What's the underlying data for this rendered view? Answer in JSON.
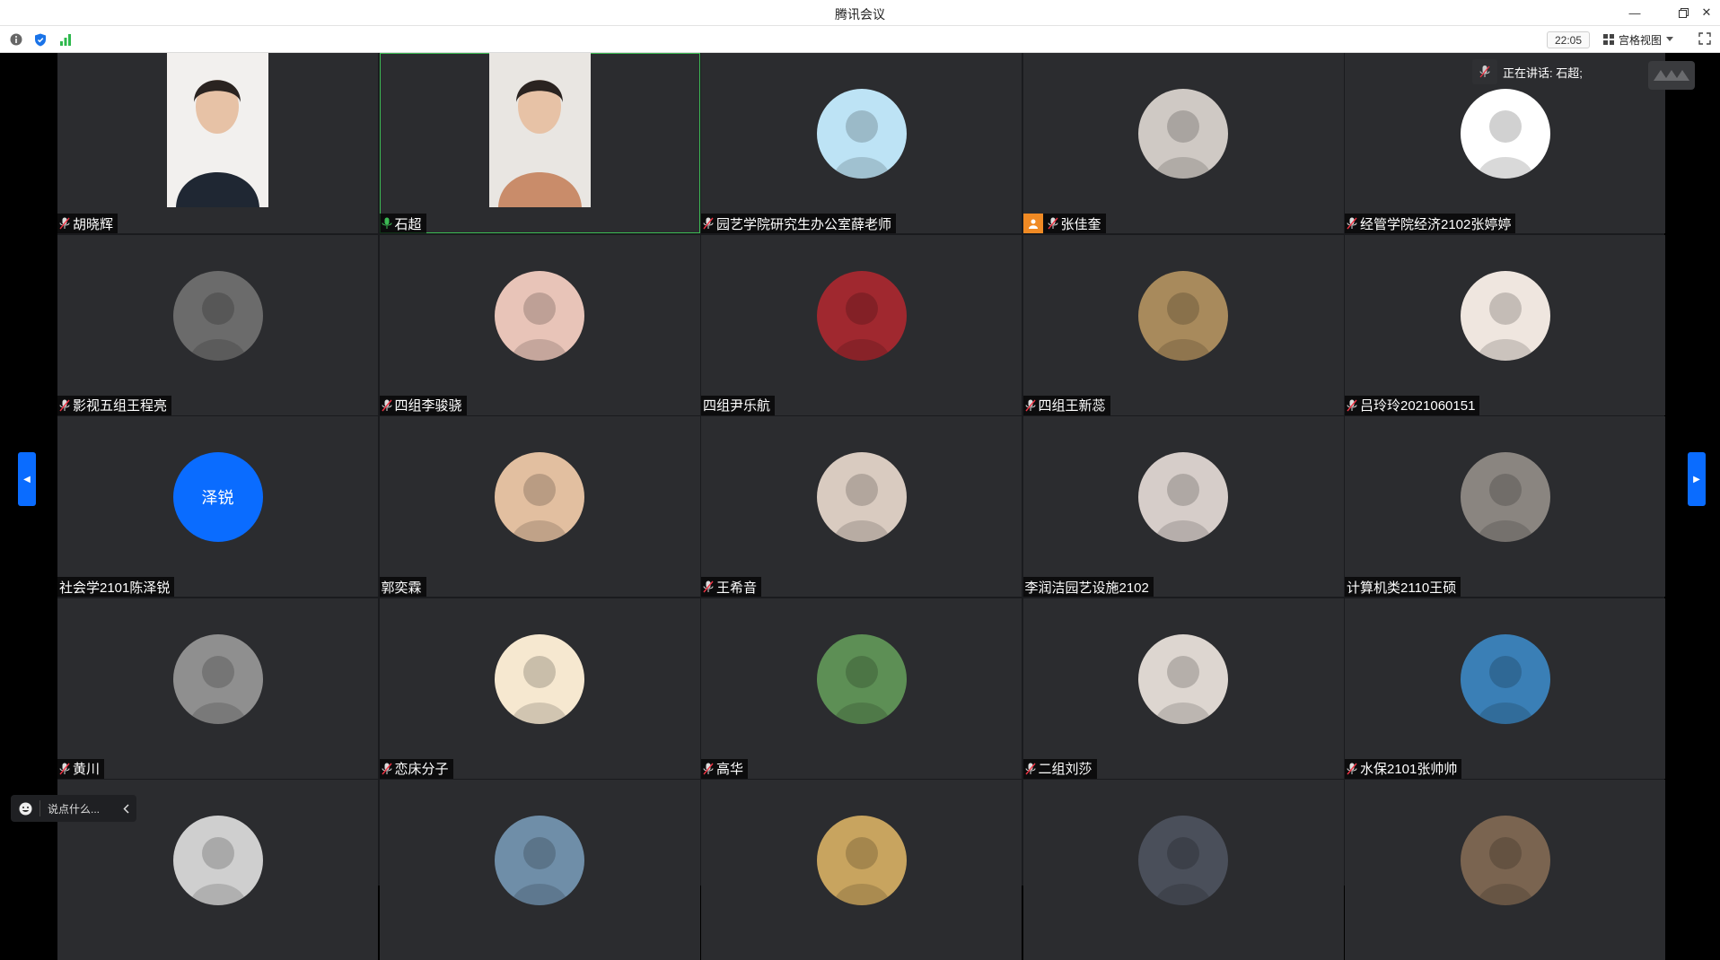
{
  "window": {
    "title": "腾讯会议"
  },
  "toolbar": {
    "time": "22:05",
    "view_label": "宫格视图"
  },
  "speaker": {
    "label": "正在讲话: 石超;"
  },
  "chat": {
    "placeholder": "说点什么..."
  },
  "participants": [
    {
      "name": "胡晓辉",
      "mic": "muted",
      "kind": "video",
      "bg": "#3a3531"
    },
    {
      "name": "石超",
      "mic": "active",
      "kind": "video",
      "bg": "#3b3734",
      "speaking": true
    },
    {
      "name": "园艺学院研究生办公室薛老师",
      "mic": "muted",
      "kind": "avatar",
      "color": "#bde3f5",
      "icon": "cartoon-glasses-avatar"
    },
    {
      "name": "张佳奎",
      "mic": "muted",
      "kind": "avatar",
      "color": "#cfc9c4",
      "icon": "photo-avatar",
      "badge": true
    },
    {
      "name": "经管学院经济2102张婷婷",
      "mic": "muted",
      "kind": "avatar",
      "color": "#ffffff",
      "icon": "potato-avatar"
    },
    {
      "name": "影视五组王程亮",
      "mic": "muted",
      "kind": "avatar",
      "color": "#6b6b6b",
      "icon": "wolf-avatar"
    },
    {
      "name": "四组李骏骁",
      "mic": "muted",
      "kind": "avatar",
      "color": "#e8c4b8",
      "icon": "blossom-avatar"
    },
    {
      "name": "四组尹乐航",
      "mic": "none",
      "kind": "avatar",
      "color": "#a0282f",
      "icon": "quote-avatar"
    },
    {
      "name": "四组王新蕊",
      "mic": "muted",
      "kind": "avatar",
      "color": "#a88a5c",
      "icon": "photo-avatar"
    },
    {
      "name": "吕玲玲2021060151",
      "mic": "muted",
      "kind": "avatar",
      "color": "#efe6df",
      "icon": "girl-avatar"
    },
    {
      "name": "社会学2101陈泽锐",
      "mic": "none",
      "kind": "text",
      "initials": "泽锐"
    },
    {
      "name": "郭奕霖",
      "mic": "none",
      "kind": "avatar",
      "color": "#e2bfa0",
      "icon": "anime-avatar"
    },
    {
      "name": "王希音",
      "mic": "muted",
      "kind": "avatar",
      "color": "#d9cbc0",
      "icon": "flowers-avatar"
    },
    {
      "name": "李润洁园艺设施2102",
      "mic": "none",
      "kind": "avatar",
      "color": "#d6cdc9",
      "icon": "photo-avatar"
    },
    {
      "name": "计算机类2110王硕",
      "mic": "none",
      "kind": "avatar",
      "color": "#8a8580",
      "icon": "anime-avatar"
    },
    {
      "name": "黄川",
      "mic": "muted",
      "kind": "avatar",
      "color": "#8f8f8f",
      "icon": "cat-avatar"
    },
    {
      "name": "恋床分子",
      "mic": "muted",
      "kind": "avatar",
      "color": "#f6e8d0",
      "icon": "hamster-avatar"
    },
    {
      "name": "高华",
      "mic": "muted",
      "kind": "avatar",
      "color": "#5d8f55",
      "icon": "campus-avatar"
    },
    {
      "name": "二组刘莎",
      "mic": "muted",
      "kind": "avatar",
      "color": "#ddd6d0",
      "icon": "photo-avatar"
    },
    {
      "name": "水保2101张帅帅",
      "mic": "muted",
      "kind": "avatar",
      "color": "#3a7fb6",
      "icon": "cartoon-cat-avatar"
    },
    {
      "name": "",
      "mic": "none",
      "kind": "avatar",
      "color": "#cfcfcf",
      "icon": "sketch-avatar"
    },
    {
      "name": "",
      "mic": "none",
      "kind": "avatar",
      "color": "#6f8ea8",
      "icon": "sky-avatar"
    },
    {
      "name": "",
      "mic": "none",
      "kind": "avatar",
      "color": "#c8a45f",
      "icon": "anime-avatar"
    },
    {
      "name": "",
      "mic": "none",
      "kind": "avatar",
      "color": "#4a4f5a",
      "icon": "cartoon-avatar"
    },
    {
      "name": "",
      "mic": "none",
      "kind": "avatar",
      "color": "#7a6450",
      "icon": "room-avatar"
    }
  ]
}
